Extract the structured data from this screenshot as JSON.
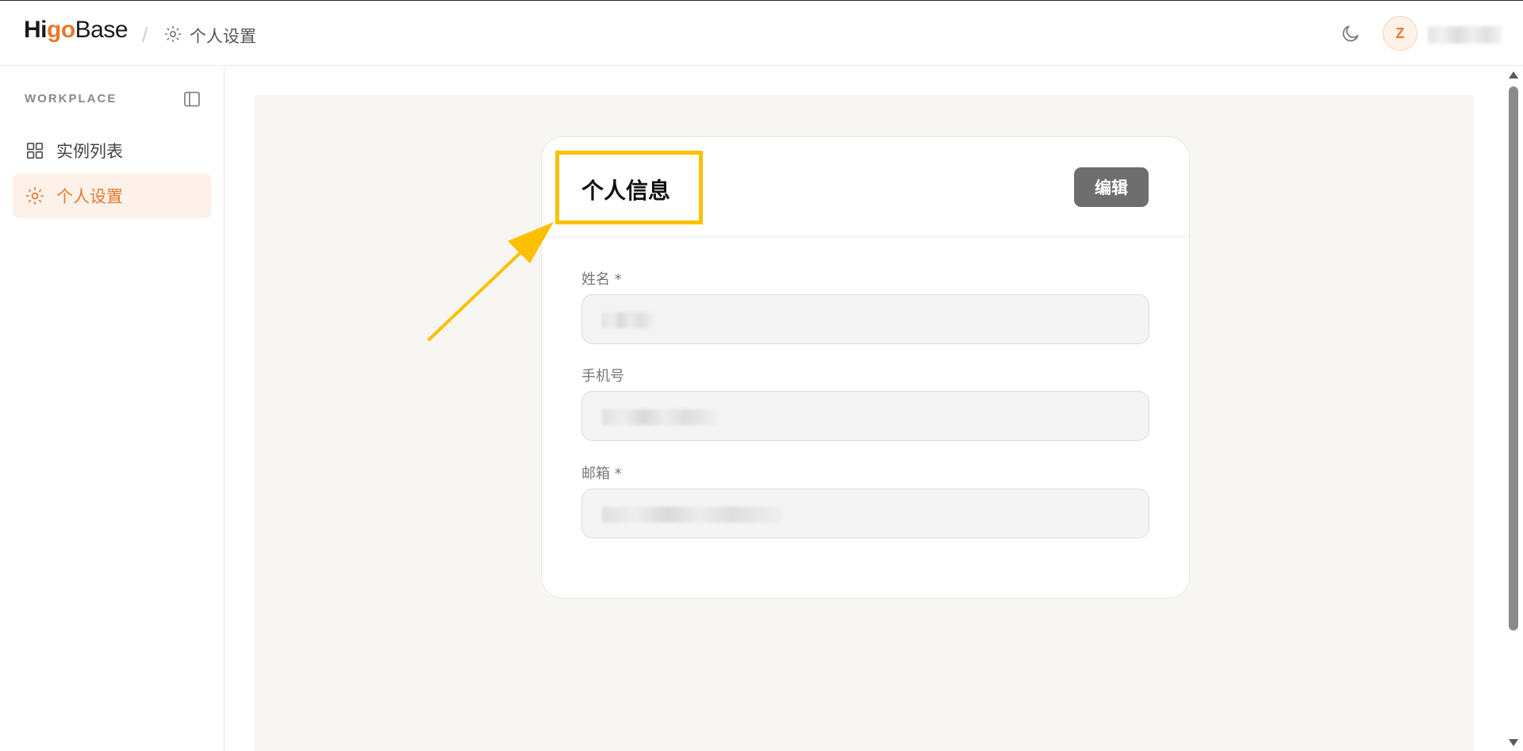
{
  "app": {
    "logo_pre": "Hi",
    "logo_o": "go",
    "logo_post": "Base"
  },
  "breadcrumb": {
    "current": "个人设置"
  },
  "user": {
    "avatar_letter": "Z"
  },
  "sidebar": {
    "title": "WORKPLACE",
    "items": [
      {
        "label": "实例列表",
        "icon": "grid-icon",
        "active": false
      },
      {
        "label": "个人设置",
        "icon": "sun-gear-icon",
        "active": true
      }
    ]
  },
  "card": {
    "title": "个人信息",
    "edit_label": "编辑",
    "fields": [
      {
        "label": "姓名 *"
      },
      {
        "label": "手机号"
      },
      {
        "label": "邮箱 *"
      }
    ]
  },
  "colors": {
    "accent": "#e8792b",
    "highlight": "#fcc000",
    "button": "#6e6e6e"
  }
}
